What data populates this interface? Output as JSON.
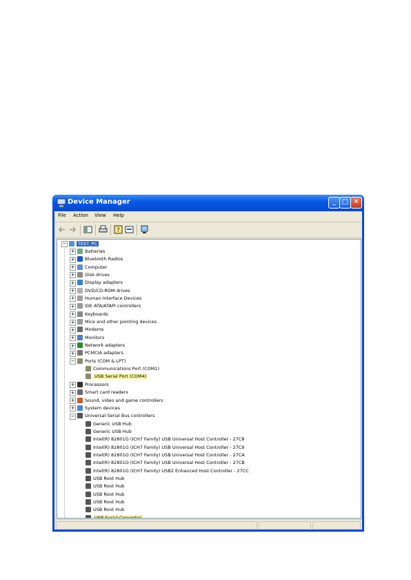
{
  "window": {
    "title": "Device Manager"
  },
  "menu": [
    "File",
    "Action",
    "View",
    "Help"
  ],
  "toolbar": [
    "back-icon",
    "forward-icon",
    "properties-view-icon",
    "print-icon",
    "help-icon",
    "update-driver-icon",
    "scan-hardware-icon"
  ],
  "tree": {
    "root": "TEST_PC",
    "categories": [
      {
        "label": "Batteries",
        "icon": "battery-icon"
      },
      {
        "label": "Bluetooth Radios",
        "icon": "bluetooth-icon"
      },
      {
        "label": "Computer",
        "icon": "computer-icon"
      },
      {
        "label": "Disk drives",
        "icon": "disk-icon"
      },
      {
        "label": "Display adapters",
        "icon": "display-icon"
      },
      {
        "label": "DVD/CD-ROM drives",
        "icon": "cdrom-icon"
      },
      {
        "label": "Human Interface Devices",
        "icon": "hid-icon"
      },
      {
        "label": "IDE ATA/ATAPI controllers",
        "icon": "ide-icon"
      },
      {
        "label": "Keyboards",
        "icon": "keyboard-icon"
      },
      {
        "label": "Mice and other pointing devices",
        "icon": "mouse-icon"
      },
      {
        "label": "Modems",
        "icon": "modem-icon"
      },
      {
        "label": "Monitors",
        "icon": "monitor-icon"
      },
      {
        "label": "Network adapters",
        "icon": "network-icon"
      },
      {
        "label": "PCMCIA adapters",
        "icon": "pcmcia-icon"
      },
      {
        "label": "Ports (COM & LPT)",
        "icon": "port-icon",
        "expanded": true,
        "children": [
          {
            "label": "Communications Port (COM1)",
            "icon": "port-icon"
          },
          {
            "label": "USB Serial Port (COM4)",
            "icon": "port-icon",
            "highlight": true
          }
        ]
      },
      {
        "label": "Processors",
        "icon": "cpu-icon"
      },
      {
        "label": "Smart card readers",
        "icon": "smartcard-icon"
      },
      {
        "label": "Sound, video and game controllers",
        "icon": "sound-icon"
      },
      {
        "label": "System devices",
        "icon": "system-icon"
      },
      {
        "label": "Universal Serial Bus controllers",
        "icon": "usb-icon",
        "expanded": true,
        "children": [
          {
            "label": "Generic USB Hub",
            "icon": "usb-icon"
          },
          {
            "label": "Generic USB Hub",
            "icon": "usb-icon"
          },
          {
            "label": "Intel(R) 82801G (ICH7 Family) USB Universal Host Controller - 27C8",
            "icon": "usb-icon"
          },
          {
            "label": "Intel(R) 82801G (ICH7 Family) USB Universal Host Controller - 27C9",
            "icon": "usb-icon"
          },
          {
            "label": "Intel(R) 82801G (ICH7 Family) USB Universal Host Controller - 27CA",
            "icon": "usb-icon"
          },
          {
            "label": "Intel(R) 82801G (ICH7 Family) USB Universal Host Controller - 27CB",
            "icon": "usb-icon"
          },
          {
            "label": "Intel(R) 82801G (ICH7 Family) USB2 Enhanced Host Controller - 27CC",
            "icon": "usb-icon"
          },
          {
            "label": "USB Root Hub",
            "icon": "usb-icon"
          },
          {
            "label": "USB Root Hub",
            "icon": "usb-icon"
          },
          {
            "label": "USB Root Hub",
            "icon": "usb-icon"
          },
          {
            "label": "USB Root Hub",
            "icon": "usb-icon"
          },
          {
            "label": "USB Root Hub",
            "icon": "usb-icon"
          },
          {
            "label": "USB Serial Converter",
            "icon": "usb-icon",
            "highlight": true
          }
        ]
      }
    ]
  },
  "colors": {
    "titlebar": "#0a5ae6",
    "highlight": "#fdf5a8",
    "selection": "#316ac5"
  }
}
